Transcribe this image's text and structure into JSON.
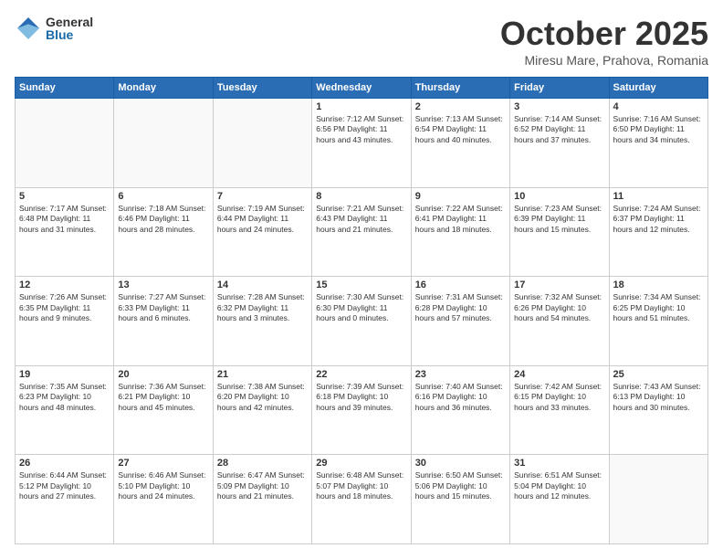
{
  "header": {
    "logo_general": "General",
    "logo_blue": "Blue",
    "month": "October 2025",
    "location": "Miresu Mare, Prahova, Romania"
  },
  "weekdays": [
    "Sunday",
    "Monday",
    "Tuesday",
    "Wednesday",
    "Thursday",
    "Friday",
    "Saturday"
  ],
  "weeks": [
    [
      {
        "day": "",
        "info": ""
      },
      {
        "day": "",
        "info": ""
      },
      {
        "day": "",
        "info": ""
      },
      {
        "day": "1",
        "info": "Sunrise: 7:12 AM\nSunset: 6:56 PM\nDaylight: 11 hours and 43 minutes."
      },
      {
        "day": "2",
        "info": "Sunrise: 7:13 AM\nSunset: 6:54 PM\nDaylight: 11 hours and 40 minutes."
      },
      {
        "day": "3",
        "info": "Sunrise: 7:14 AM\nSunset: 6:52 PM\nDaylight: 11 hours and 37 minutes."
      },
      {
        "day": "4",
        "info": "Sunrise: 7:16 AM\nSunset: 6:50 PM\nDaylight: 11 hours and 34 minutes."
      }
    ],
    [
      {
        "day": "5",
        "info": "Sunrise: 7:17 AM\nSunset: 6:48 PM\nDaylight: 11 hours and 31 minutes."
      },
      {
        "day": "6",
        "info": "Sunrise: 7:18 AM\nSunset: 6:46 PM\nDaylight: 11 hours and 28 minutes."
      },
      {
        "day": "7",
        "info": "Sunrise: 7:19 AM\nSunset: 6:44 PM\nDaylight: 11 hours and 24 minutes."
      },
      {
        "day": "8",
        "info": "Sunrise: 7:21 AM\nSunset: 6:43 PM\nDaylight: 11 hours and 21 minutes."
      },
      {
        "day": "9",
        "info": "Sunrise: 7:22 AM\nSunset: 6:41 PM\nDaylight: 11 hours and 18 minutes."
      },
      {
        "day": "10",
        "info": "Sunrise: 7:23 AM\nSunset: 6:39 PM\nDaylight: 11 hours and 15 minutes."
      },
      {
        "day": "11",
        "info": "Sunrise: 7:24 AM\nSunset: 6:37 PM\nDaylight: 11 hours and 12 minutes."
      }
    ],
    [
      {
        "day": "12",
        "info": "Sunrise: 7:26 AM\nSunset: 6:35 PM\nDaylight: 11 hours and 9 minutes."
      },
      {
        "day": "13",
        "info": "Sunrise: 7:27 AM\nSunset: 6:33 PM\nDaylight: 11 hours and 6 minutes."
      },
      {
        "day": "14",
        "info": "Sunrise: 7:28 AM\nSunset: 6:32 PM\nDaylight: 11 hours and 3 minutes."
      },
      {
        "day": "15",
        "info": "Sunrise: 7:30 AM\nSunset: 6:30 PM\nDaylight: 11 hours and 0 minutes."
      },
      {
        "day": "16",
        "info": "Sunrise: 7:31 AM\nSunset: 6:28 PM\nDaylight: 10 hours and 57 minutes."
      },
      {
        "day": "17",
        "info": "Sunrise: 7:32 AM\nSunset: 6:26 PM\nDaylight: 10 hours and 54 minutes."
      },
      {
        "day": "18",
        "info": "Sunrise: 7:34 AM\nSunset: 6:25 PM\nDaylight: 10 hours and 51 minutes."
      }
    ],
    [
      {
        "day": "19",
        "info": "Sunrise: 7:35 AM\nSunset: 6:23 PM\nDaylight: 10 hours and 48 minutes."
      },
      {
        "day": "20",
        "info": "Sunrise: 7:36 AM\nSunset: 6:21 PM\nDaylight: 10 hours and 45 minutes."
      },
      {
        "day": "21",
        "info": "Sunrise: 7:38 AM\nSunset: 6:20 PM\nDaylight: 10 hours and 42 minutes."
      },
      {
        "day": "22",
        "info": "Sunrise: 7:39 AM\nSunset: 6:18 PM\nDaylight: 10 hours and 39 minutes."
      },
      {
        "day": "23",
        "info": "Sunrise: 7:40 AM\nSunset: 6:16 PM\nDaylight: 10 hours and 36 minutes."
      },
      {
        "day": "24",
        "info": "Sunrise: 7:42 AM\nSunset: 6:15 PM\nDaylight: 10 hours and 33 minutes."
      },
      {
        "day": "25",
        "info": "Sunrise: 7:43 AM\nSunset: 6:13 PM\nDaylight: 10 hours and 30 minutes."
      }
    ],
    [
      {
        "day": "26",
        "info": "Sunrise: 6:44 AM\nSunset: 5:12 PM\nDaylight: 10 hours and 27 minutes."
      },
      {
        "day": "27",
        "info": "Sunrise: 6:46 AM\nSunset: 5:10 PM\nDaylight: 10 hours and 24 minutes."
      },
      {
        "day": "28",
        "info": "Sunrise: 6:47 AM\nSunset: 5:09 PM\nDaylight: 10 hours and 21 minutes."
      },
      {
        "day": "29",
        "info": "Sunrise: 6:48 AM\nSunset: 5:07 PM\nDaylight: 10 hours and 18 minutes."
      },
      {
        "day": "30",
        "info": "Sunrise: 6:50 AM\nSunset: 5:06 PM\nDaylight: 10 hours and 15 minutes."
      },
      {
        "day": "31",
        "info": "Sunrise: 6:51 AM\nSunset: 5:04 PM\nDaylight: 10 hours and 12 minutes."
      },
      {
        "day": "",
        "info": ""
      }
    ]
  ]
}
